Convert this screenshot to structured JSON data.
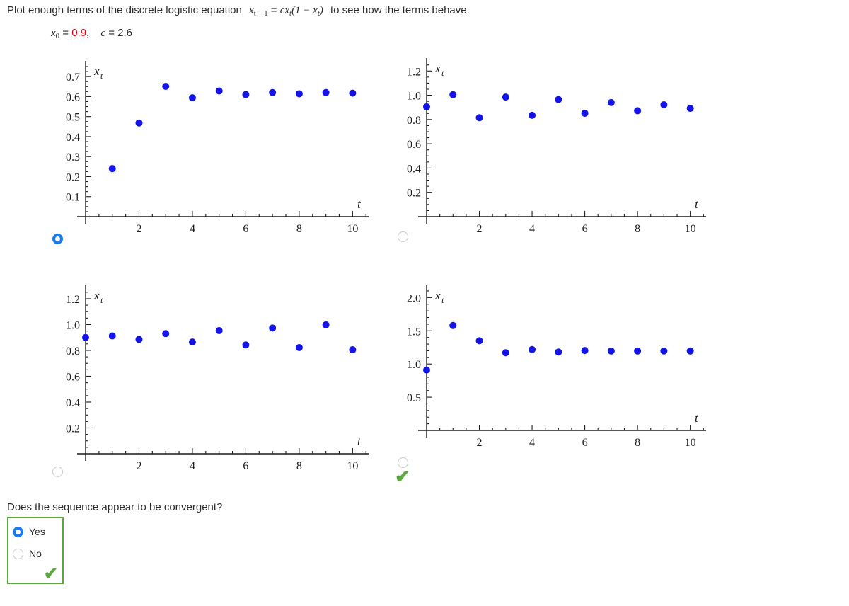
{
  "prompt": {
    "text_before": "Plot enough terms of the discrete logistic equation",
    "equation": "x_{t+1} = c x_t (1 - x_t)",
    "equation_parts": {
      "lhs_var": "x",
      "lhs_sub": "t + 1",
      "eq": "=",
      "rhs": "cx",
      "rhs_sub": "t",
      "rhs_tail_open": "(1 − x",
      "rhs_tail_sub": "t",
      "rhs_tail_close": ")"
    },
    "text_after": "to see how the terms behave."
  },
  "params": {
    "x0_label": "x",
    "x0_sub": "0",
    "x0_eq": "=",
    "x0_value": "0.9",
    "comma": ",",
    "c_label": "c",
    "c_eq": "=",
    "c_value": "2.6"
  },
  "question": {
    "text": "Does the sequence appear to be convergent?",
    "options": [
      {
        "label": "Yes",
        "selected": true
      },
      {
        "label": "No",
        "selected": false
      }
    ],
    "graded_correct": true,
    "check_glyph": "✔"
  },
  "options_state": [
    {
      "id": "choice-a",
      "selected": true,
      "correct_mark": false
    },
    {
      "id": "choice-b",
      "selected": false,
      "correct_mark": false
    },
    {
      "id": "choice-c",
      "selected": false,
      "correct_mark": false
    },
    {
      "id": "choice-d",
      "selected": false,
      "correct_mark": true
    }
  ],
  "colors": {
    "point": "#1414e6",
    "axis": "#1c1c1c",
    "accent_red": "#e8000d",
    "radio_selected": "#1a7af5",
    "check_green": "#5aa83f",
    "box_border": "#5aa83f"
  },
  "chart_data": [
    {
      "id": "choice-a",
      "type": "scatter",
      "title": "",
      "xlabel": "t",
      "ylabel": "x_t",
      "xlim": [
        0,
        10.6
      ],
      "ylim": [
        0,
        0.75
      ],
      "xticks": [
        2,
        4,
        6,
        8,
        10
      ],
      "xtick_labels": [
        "2",
        "4",
        "6",
        "8",
        "10"
      ],
      "yticks": [
        0.1,
        0.2,
        0.3,
        0.4,
        0.5,
        0.6,
        0.7
      ],
      "ytick_labels": [
        "0.1",
        "0.2",
        "0.3",
        "0.4",
        "0.5",
        "0.6",
        "0.7"
      ],
      "minor_tick_step_x": 0.5,
      "minor_tick_step_y": 0.025,
      "grid": false,
      "x": [
        1,
        2,
        3,
        4,
        5,
        6,
        7,
        8,
        9,
        10
      ],
      "y": [
        0.24,
        0.468,
        0.651,
        0.594,
        0.628,
        0.61,
        0.62,
        0.614,
        0.62,
        0.617
      ]
    },
    {
      "id": "choice-b",
      "type": "scatter",
      "title": "",
      "xlabel": "t",
      "ylabel": "x_t",
      "xlim": [
        0,
        10.6
      ],
      "ylim": [
        0,
        1.26
      ],
      "xticks": [
        2,
        4,
        6,
        8,
        10
      ],
      "xtick_labels": [
        "2",
        "4",
        "6",
        "8",
        "10"
      ],
      "yticks": [
        0.2,
        0.4,
        0.6,
        0.8,
        1.0,
        1.2
      ],
      "ytick_labels": [
        "0.2",
        "0.4",
        "0.6",
        "0.8",
        "1.0",
        "1.2"
      ],
      "minor_tick_step_x": 0.5,
      "minor_tick_step_y": 0.05,
      "grid": false,
      "x": [
        0,
        1,
        2,
        3,
        4,
        5,
        6,
        7,
        8,
        9,
        10
      ],
      "y": [
        0.905,
        1.005,
        0.815,
        0.985,
        0.835,
        0.965,
        0.852,
        0.94,
        0.873,
        0.922,
        0.892
      ]
    },
    {
      "id": "choice-c",
      "type": "scatter",
      "title": "",
      "xlabel": "t",
      "ylabel": "x_t",
      "xlim": [
        0,
        10.6
      ],
      "ylim": [
        0,
        1.26
      ],
      "xticks": [
        2,
        4,
        6,
        8,
        10
      ],
      "xtick_labels": [
        "2",
        "4",
        "6",
        "8",
        "10"
      ],
      "yticks": [
        0.2,
        0.4,
        0.6,
        0.8,
        1.0,
        1.2
      ],
      "ytick_labels": [
        "0.2",
        "0.4",
        "0.6",
        "0.8",
        "1.0",
        "1.2"
      ],
      "minor_tick_step_x": 0.5,
      "minor_tick_step_y": 0.05,
      "grid": false,
      "x": [
        0,
        1,
        2,
        3,
        4,
        5,
        6,
        7,
        8,
        9,
        10
      ],
      "y": [
        0.9,
        0.912,
        0.885,
        0.93,
        0.865,
        0.953,
        0.842,
        0.973,
        0.822,
        0.998,
        0.805
      ]
    },
    {
      "id": "choice-d",
      "type": "scatter",
      "title": "",
      "xlabel": "t",
      "ylabel": "x_t",
      "xlim": [
        0,
        10.6
      ],
      "ylim": [
        0,
        2.1
      ],
      "xticks": [
        2,
        4,
        6,
        8,
        10
      ],
      "xtick_labels": [
        "2",
        "4",
        "6",
        "8",
        "10"
      ],
      "yticks": [
        0.5,
        1.0,
        1.5,
        2.0
      ],
      "ytick_labels": [
        "0.5",
        "1.0",
        "1.5",
        "2.0"
      ],
      "minor_tick_step_x": 0.5,
      "minor_tick_step_y": 0.1,
      "grid": false,
      "x": [
        0,
        1,
        2,
        3,
        4,
        5,
        6,
        7,
        8,
        9,
        10
      ],
      "y": [
        0.91,
        1.58,
        1.35,
        1.17,
        1.218,
        1.18,
        1.203,
        1.195,
        1.196,
        1.196,
        1.196
      ]
    }
  ]
}
